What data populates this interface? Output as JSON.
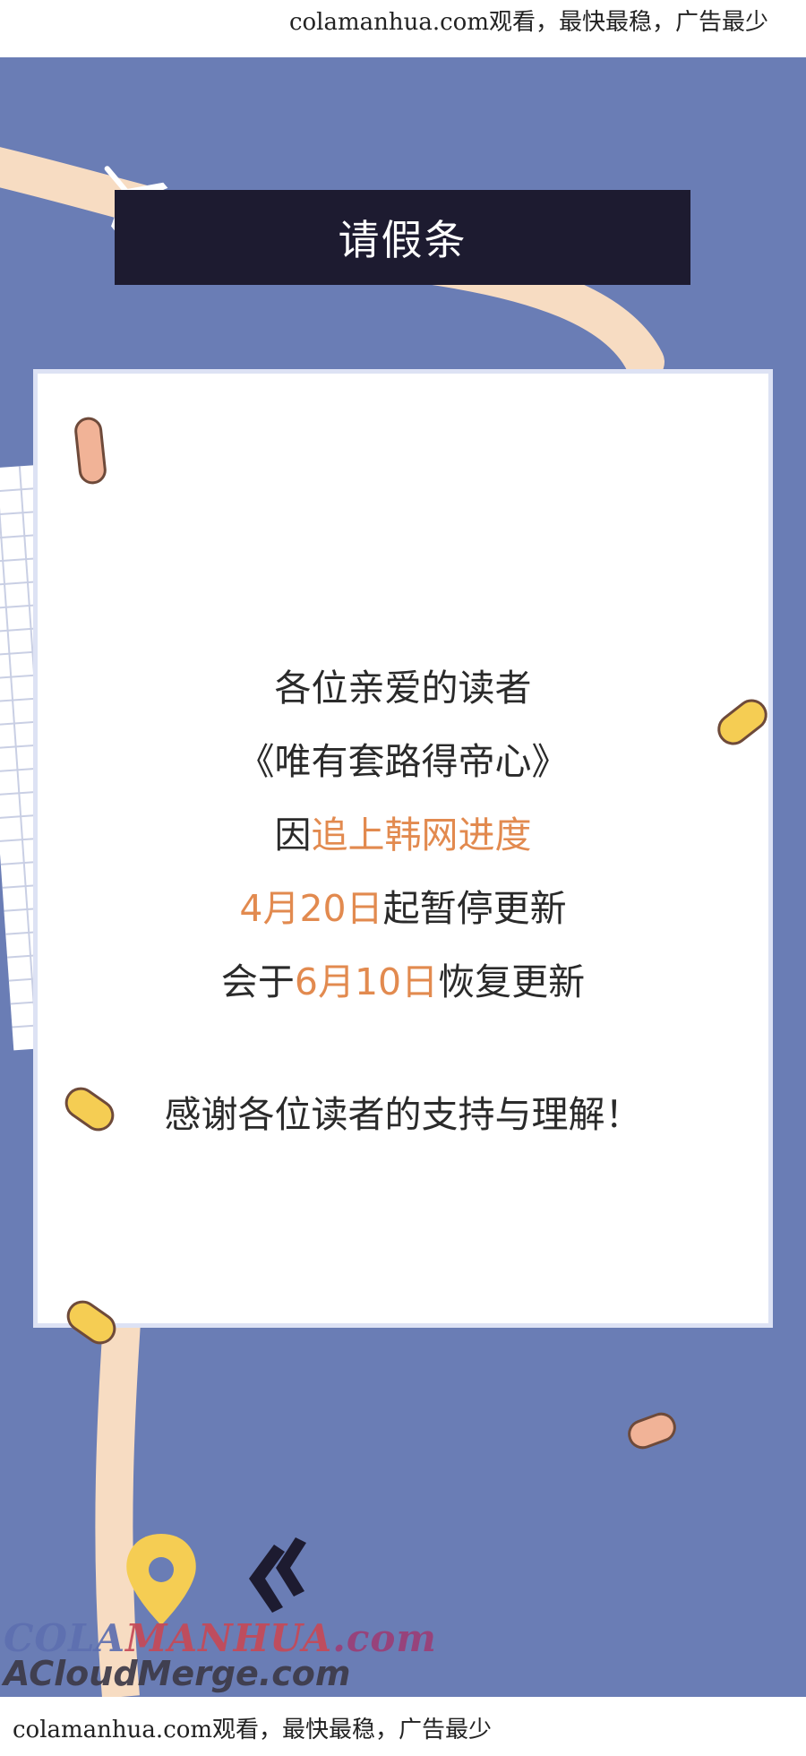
{
  "banners": {
    "top_text": "colamanhua.com观看，最快最稳，广告最少",
    "bottom_text": "colamanhua.com观看，最快最稳，广告最少"
  },
  "poster": {
    "title": "请假条",
    "notice": {
      "greeting": "各位亲爱的读者",
      "work_title": "《唯有套路得帝心》",
      "reason_prefix": "因",
      "reason_highlight": "追上韩网进度",
      "pause_date": "4月20日",
      "pause_text": "起暂停更新",
      "resume_prefix": "会于",
      "resume_date": "6月10日",
      "resume_text": "恢复更新",
      "thanks": "感谢各位读者的支持与理解！"
    },
    "colors": {
      "background": "#6a7db5",
      "title_bar": "#1d1b30",
      "highlight": "#e28a4f",
      "road": "#f7dcc2",
      "pill_yellow": "#f5cd53",
      "pill_peach": "#f1b397"
    }
  },
  "watermark": {
    "line1_part1": "COLA",
    "line1_part2": "MANHUA",
    "line1_part3": ".com",
    "line2": "ACloudMerge.com"
  }
}
